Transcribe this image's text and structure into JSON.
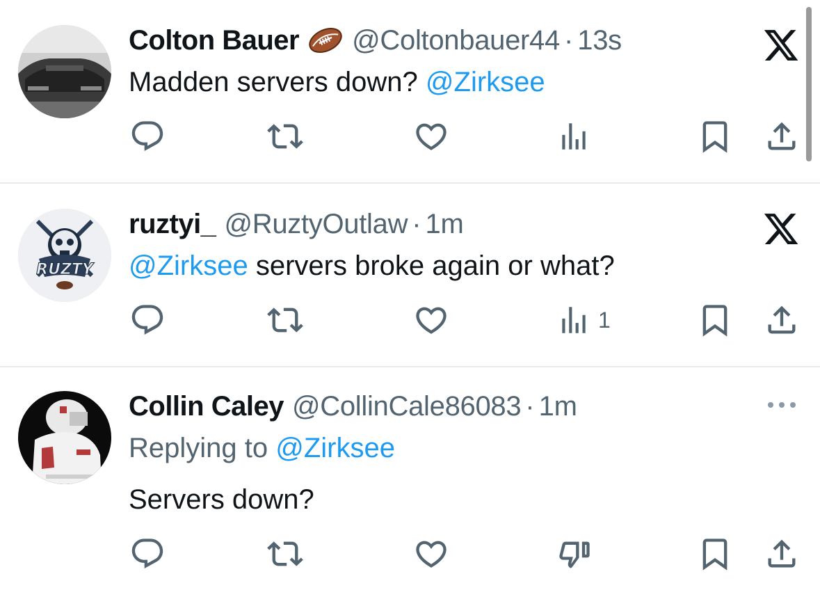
{
  "tweets": [
    {
      "name": "Colton Bauer",
      "handle": "@Coltonbauer44",
      "separator": "·",
      "time": "13s",
      "badge_emoji": "football-emoji",
      "text_before": "Madden servers down? ",
      "mention": "@Zirksee",
      "text_after": "",
      "top_right_icon": "x-logo-icon",
      "actions": {
        "views_count": ""
      }
    },
    {
      "name": "ruztyi_",
      "handle": "@RuztyOutlaw",
      "separator": "·",
      "time": "1m",
      "text_before": "",
      "mention": "@Zirksee",
      "text_after": " servers broke again or what?",
      "avatar_text": "RUZTY",
      "top_right_icon": "x-logo-icon",
      "actions": {
        "views_count": "1"
      }
    },
    {
      "name": "Collin Caley",
      "handle": "@CollinCale86083",
      "separator": "·",
      "time": "1m",
      "replying_to_label": "Replying to ",
      "replying_to_mention": "@Zirksee",
      "text": "Servers down?",
      "top_right_icon": "more-icon",
      "actions": {
        "downvote_icon": "thumbs-down-icon"
      }
    }
  ],
  "colors": {
    "accent": "#1d9bf0",
    "text_primary": "#0f1419",
    "text_secondary": "#536471",
    "divider": "#e7e9ea"
  }
}
